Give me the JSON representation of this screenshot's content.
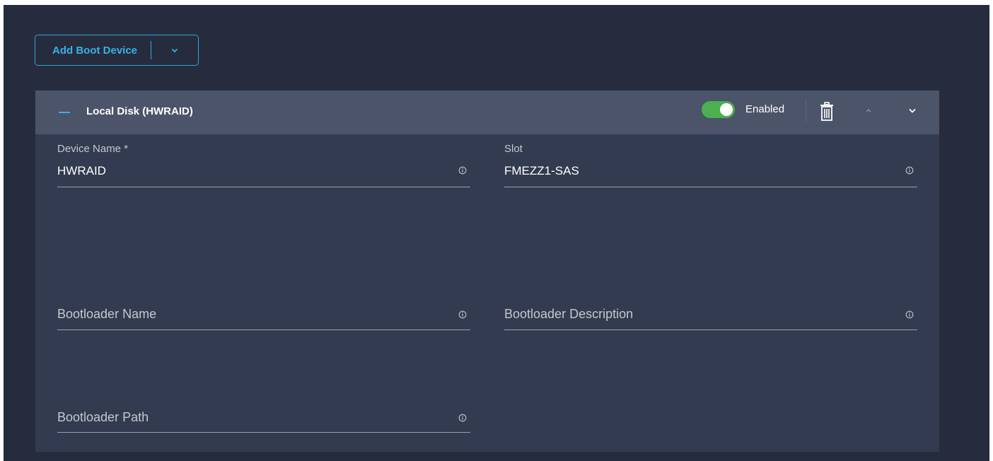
{
  "add_boot_device": {
    "label": "Add Boot Device",
    "icon": "chevron-down-icon"
  },
  "boot_device": {
    "title": "Local Disk (HWRAID)",
    "toggle": {
      "state": true,
      "label": "Enabled"
    },
    "icons": [
      "minus-icon",
      "trash-icon",
      "chevron-up-icon",
      "chevron-down-icon"
    ]
  },
  "fields": {
    "device_name": {
      "label": "Device Name *",
      "value": "HWRAID"
    },
    "slot": {
      "label": "Slot",
      "value": "FMEZZ1-SAS"
    },
    "bootloader_name": {
      "placeholder": "Bootloader Name"
    },
    "bootloader_description": {
      "placeholder": "Bootloader Description"
    },
    "bootloader_path": {
      "placeholder": "Bootloader Path"
    }
  },
  "colors": {
    "background": "#262c3e",
    "panel": "#323b4f",
    "panel_header": "#4c5469",
    "accent": "#2aa7d8",
    "toggle_on": "#4caf50"
  }
}
